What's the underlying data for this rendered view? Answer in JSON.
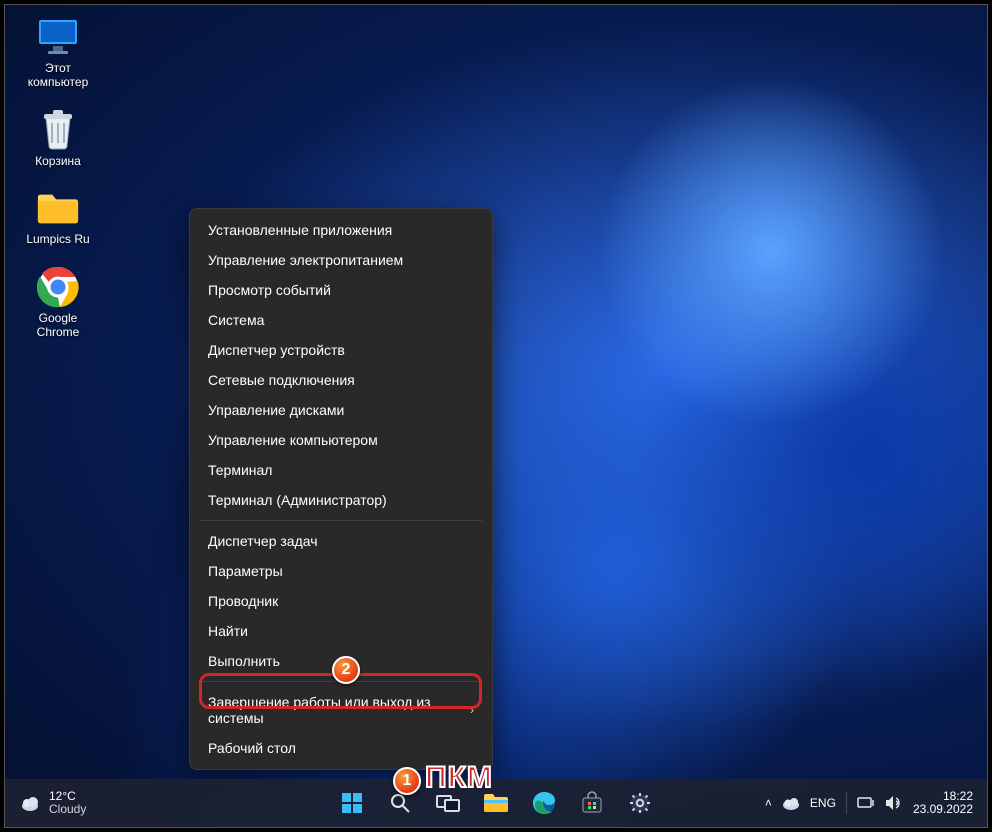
{
  "desktop_icons": [
    {
      "name": "this-pc",
      "label": "Этот\nкомпьютер"
    },
    {
      "name": "recycle",
      "label": "Корзина"
    },
    {
      "name": "folder",
      "label": "Lumpics Ru"
    },
    {
      "name": "chrome",
      "label": "Google\nChrome"
    }
  ],
  "context_menu": {
    "groups": [
      [
        "Установленные приложения",
        "Управление электропитанием",
        "Просмотр событий",
        "Система",
        "Диспетчер устройств",
        "Сетевые подключения",
        "Управление дисками",
        "Управление компьютером",
        "Терминал",
        "Терминал (Администратор)"
      ],
      [
        "Диспетчер задач",
        "Параметры",
        "Проводник",
        "Найти",
        "Выполнить"
      ],
      [
        {
          "label": "Завершение работы или выход из системы",
          "submenu": true
        },
        "Рабочий стол"
      ]
    ],
    "highlighted": "Выполнить"
  },
  "annotations": {
    "badge1": "1",
    "badge2": "2",
    "pkm": "ПКМ"
  },
  "taskbar": {
    "weather": {
      "temp": "12°C",
      "desc": "Cloudy"
    },
    "center": [
      "start",
      "search",
      "task-view",
      "explorer",
      "edge",
      "store",
      "settings"
    ],
    "tray": {
      "lang": "ENG",
      "time": "18:22",
      "date": "23.09.2022"
    }
  }
}
